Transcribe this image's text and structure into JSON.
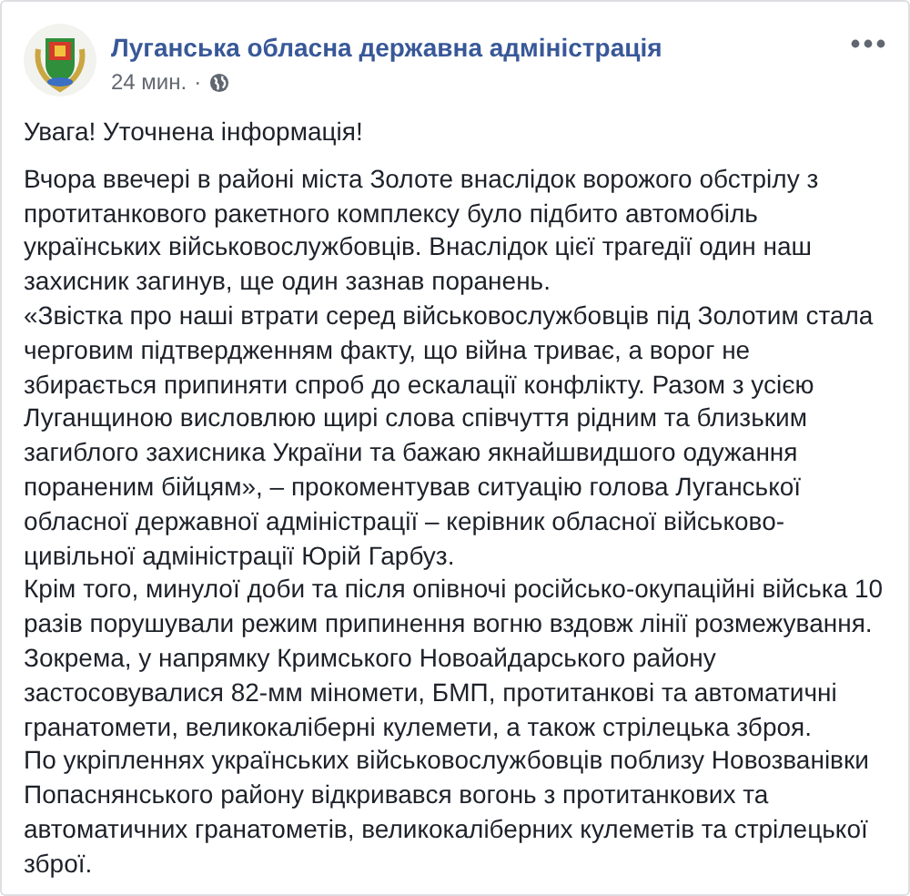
{
  "post": {
    "author": "Луганська обласна державна адміністрація",
    "time": "24 мин.",
    "separator": "·",
    "paragraphs": [
      "Увага! Уточнена інформація!",
      "Вчора ввечері в районі міста Золоте внаслідок ворожого обстрілу з протитанкового ракетного комплексу було підбито автомобіль українських військовослужбовців. Внаслідок цієї трагедії один наш захисник загинув, ще один зазнав поранень.",
      "«Звістка про наші втрати серед військовослужбовців під Золотим стала черговим підтвердженням факту, що війна триває, а ворог не збирається припиняти спроб до ескалації конфлікту. Разом з усією Луганщиною висловлюю щирі слова співчуття рідним та близьким загиблого захисника України та бажаю якнайшвидшого одужання пораненим бійцям», – прокоментував ситуацію голова Луганської обласної державної адміністрації – керівник обласної військово-цивільної адміністрації Юрій Гарбуз.",
      "Крім того, минулої доби та після опівночі російсько-окупаційні війська 10 разів порушували режим припинення вогню вздовж лінії розмежування.",
      "Зокрема, у напрямку Кримського Новоайдарського району застосовувалися 82-мм міномети, БМП, протитанкові та автоматичні гранатомети, великокаліберні кулемети, а також стрілецька зброя.",
      "По укріпленнях українських військовослужбовців поблизу Новозванівки Попаснянського району відкривався вогонь з протитанкових та автоматичних гранатометів, великокаліберних кулеметів та стрілецької зброї."
    ]
  }
}
